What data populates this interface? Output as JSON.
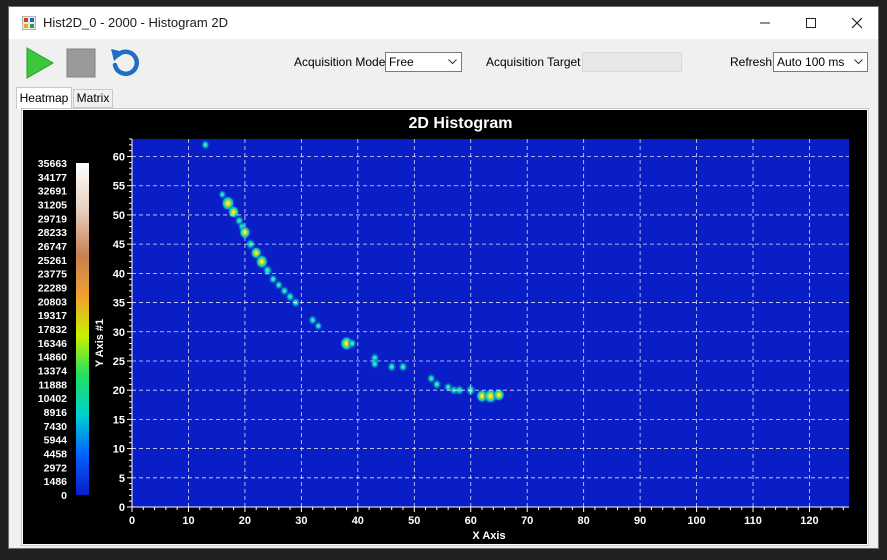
{
  "window": {
    "title": "Hist2D_0 - 2000 - Histogram 2D"
  },
  "toolbar": {
    "play_icon": "play-icon",
    "stop_icon": "stop-icon",
    "reset_icon": "refresh-icon",
    "acq_mode_label": "Acquisition Mode",
    "acq_mode_value": "Free",
    "acq_target_label": "Acquisition Target",
    "acq_target_value": "",
    "refresh_label": "Refresh",
    "refresh_value": "Auto 100 ms"
  },
  "tabs": [
    {
      "label": "Heatmap",
      "active": true
    },
    {
      "label": "Matrix",
      "active": false
    }
  ],
  "colors": {
    "plot_background": "#0a1ec8",
    "chart_background": "#000000",
    "play_green": "#3cc83c",
    "stop_gray": "#9a9a9a",
    "refresh_blue": "#1f6fc0"
  },
  "chart_data": {
    "type": "heatmap",
    "title": "2D Histogram",
    "xlabel": "X Axis",
    "ylabel": "Y Axis #1",
    "xlim": [
      0,
      127
    ],
    "ylim": [
      0,
      63
    ],
    "x_ticks": [
      0,
      10,
      20,
      30,
      40,
      50,
      60,
      70,
      80,
      90,
      100,
      110,
      120
    ],
    "y_ticks": [
      0,
      5,
      10,
      15,
      20,
      25,
      30,
      35,
      40,
      45,
      50,
      55,
      60
    ],
    "grid": true,
    "colorbar": {
      "min": 0,
      "max": 35663,
      "labels": [
        "35663",
        "34177",
        "32691",
        "31205",
        "29719",
        "28233",
        "26747",
        "25261",
        "23775",
        "22289",
        "20803",
        "19317",
        "17832",
        "16346",
        "14860",
        "13374",
        "11888",
        "10402",
        "8916",
        "7430",
        "5944",
        "4458",
        "2972",
        "1486",
        "0"
      ]
    },
    "hotspots": [
      {
        "x": 13,
        "y": 62,
        "intensity": 0.3
      },
      {
        "x": 16,
        "y": 53.5,
        "intensity": 0.2
      },
      {
        "x": 17,
        "y": 52,
        "intensity": 0.75
      },
      {
        "x": 18,
        "y": 50.5,
        "intensity": 0.55
      },
      {
        "x": 19,
        "y": 49,
        "intensity": 0.35
      },
      {
        "x": 19.5,
        "y": 48,
        "intensity": 0.3
      },
      {
        "x": 20,
        "y": 47,
        "intensity": 0.55
      },
      {
        "x": 21,
        "y": 45,
        "intensity": 0.45
      },
      {
        "x": 22,
        "y": 43.5,
        "intensity": 0.5
      },
      {
        "x": 23,
        "y": 42,
        "intensity": 0.65
      },
      {
        "x": 24,
        "y": 40.5,
        "intensity": 0.45
      },
      {
        "x": 25,
        "y": 39,
        "intensity": 0.3
      },
      {
        "x": 26,
        "y": 38,
        "intensity": 0.25
      },
      {
        "x": 27,
        "y": 37,
        "intensity": 0.3
      },
      {
        "x": 28,
        "y": 36,
        "intensity": 0.35
      },
      {
        "x": 29,
        "y": 35,
        "intensity": 0.35
      },
      {
        "x": 32,
        "y": 32,
        "intensity": 0.3
      },
      {
        "x": 33,
        "y": 31,
        "intensity": 0.2
      },
      {
        "x": 38,
        "y": 28,
        "intensity": 0.7
      },
      {
        "x": 39,
        "y": 28,
        "intensity": 0.3
      },
      {
        "x": 43,
        "y": 25.5,
        "intensity": 0.35
      },
      {
        "x": 43,
        "y": 24.5,
        "intensity": 0.3
      },
      {
        "x": 46,
        "y": 24,
        "intensity": 0.35
      },
      {
        "x": 48,
        "y": 24,
        "intensity": 0.35
      },
      {
        "x": 53,
        "y": 22,
        "intensity": 0.3
      },
      {
        "x": 54,
        "y": 21,
        "intensity": 0.35
      },
      {
        "x": 56,
        "y": 20.5,
        "intensity": 0.3
      },
      {
        "x": 57,
        "y": 20,
        "intensity": 0.3
      },
      {
        "x": 58,
        "y": 20,
        "intensity": 0.35
      },
      {
        "x": 60,
        "y": 20,
        "intensity": 0.45
      },
      {
        "x": 62,
        "y": 19,
        "intensity": 0.6
      },
      {
        "x": 63.5,
        "y": 19,
        "intensity": 0.75
      },
      {
        "x": 65,
        "y": 19.2,
        "intensity": 0.55
      }
    ]
  }
}
